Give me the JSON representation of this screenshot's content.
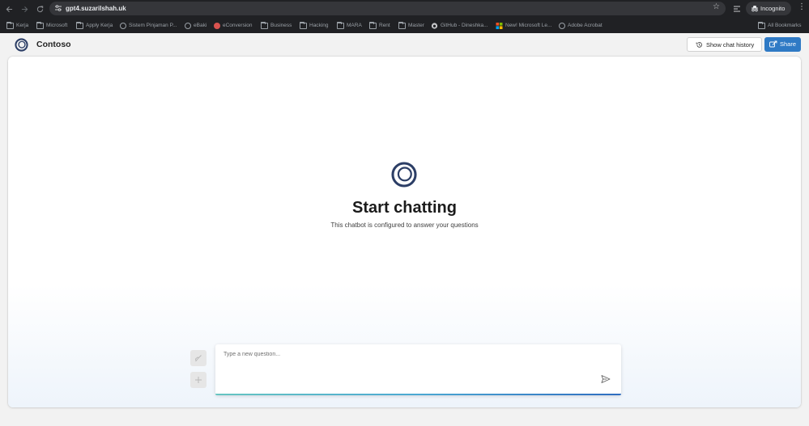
{
  "browser": {
    "url": "gpt4.suzarilshah.uk",
    "incognito_label": "Incognito",
    "bookmarks": [
      {
        "label": "Kerja",
        "icon": "folder-icon"
      },
      {
        "label": "Microsoft",
        "icon": "folder-icon"
      },
      {
        "label": "Apply Kerja",
        "icon": "folder-icon"
      },
      {
        "label": "Sistem Pinjaman P...",
        "icon": "globe-icon"
      },
      {
        "label": "eBaki",
        "icon": "globe-icon"
      },
      {
        "label": "eConversion",
        "icon": "econversion-icon"
      },
      {
        "label": "Business",
        "icon": "folder-icon"
      },
      {
        "label": "Hacking",
        "icon": "folder-icon"
      },
      {
        "label": "MARA",
        "icon": "folder-icon"
      },
      {
        "label": "Rent",
        "icon": "folder-icon"
      },
      {
        "label": "Master",
        "icon": "folder-icon"
      },
      {
        "label": "GitHub - Dineshka...",
        "icon": "github-icon"
      },
      {
        "label": "New! Microsoft Le...",
        "icon": "microsoft-icon"
      },
      {
        "label": "Adobe Acrobat",
        "icon": "globe-icon"
      }
    ],
    "all_bookmarks_label": "All Bookmarks"
  },
  "app": {
    "brand": "Contoso",
    "show_history_label": "Show chat history",
    "share_label": "Share",
    "empty_state": {
      "title": "Start chatting",
      "subtitle": "This chatbot is configured to answer your questions"
    },
    "composer": {
      "placeholder": "Type a new question..."
    }
  },
  "colors": {
    "accent": "#2f7ac5",
    "logo": "#2c3e66"
  }
}
